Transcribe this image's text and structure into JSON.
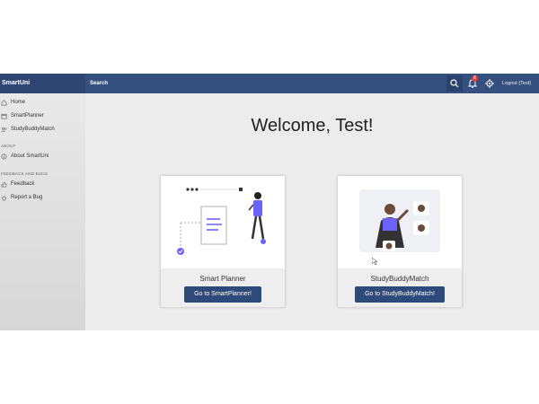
{
  "header": {
    "app_title": "SmartUni",
    "search_label": "Search",
    "notification_count": "8",
    "logout_label": "Logout (Test)"
  },
  "sidebar": {
    "items": [
      {
        "label": "Home",
        "icon": "home-icon"
      },
      {
        "label": "SmartPlanner",
        "icon": "calendar-icon"
      },
      {
        "label": "StudyBuddyMatch",
        "icon": "users-icon"
      }
    ],
    "sections": [
      {
        "title": "ABOUT",
        "items": [
          {
            "label": "About SmartUni",
            "icon": "info-icon"
          }
        ]
      },
      {
        "title": "FEEDBACK AND BUGS",
        "items": [
          {
            "label": "Feedback",
            "icon": "thumbs-up-icon"
          },
          {
            "label": "Report a Bug",
            "icon": "bug-icon"
          }
        ]
      }
    ]
  },
  "main": {
    "welcome_text": "Welcome, Test!",
    "cards": [
      {
        "title": "Smart Planner",
        "button_label": "Go to SmartPlanner!"
      },
      {
        "title": "StudyBuddyMatch",
        "button_label": "Go to StudyBuddyMatch!"
      }
    ]
  },
  "colors": {
    "header": "#35507f",
    "brand_bg": "#2f4673",
    "button": "#2e4a7a",
    "accent": "#6c63ff",
    "badge": "#e53935"
  }
}
